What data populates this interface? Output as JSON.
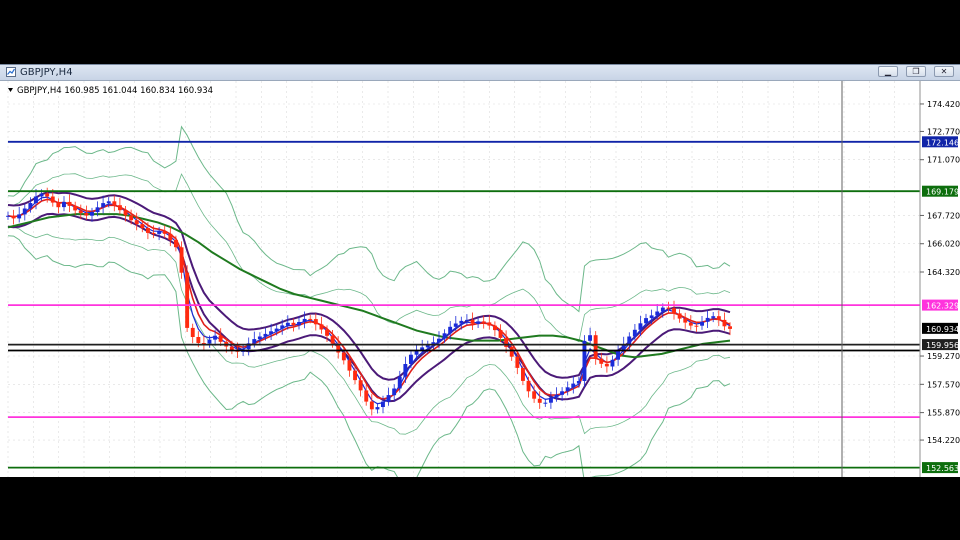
{
  "window": {
    "title": "GBPJPY,H4",
    "controls": [
      {
        "name": "minimize",
        "glyph": "▁"
      },
      {
        "name": "restore",
        "glyph": "❐"
      },
      {
        "name": "close",
        "glyph": "✕"
      }
    ]
  },
  "chart": {
    "info_line": "GBPJPY,H4  160.985 161.044 160.834 160.934",
    "colors": {
      "up": "#1a2bd8",
      "down": "#ff2a10",
      "grid": "#dcdcdc",
      "bb": "#6cb88a",
      "env": "#4b1a78",
      "ma_slow": "#1f7a1f",
      "ma_red": "#e0201a"
    },
    "price_axis": {
      "min": 152.0,
      "max": 175.8,
      "ticks": [
        "174.420",
        "172.770",
        "171.070",
        "167.720",
        "166.020",
        "164.320",
        "159.270",
        "157.570",
        "155.870",
        "154.220"
      ]
    },
    "hlines": [
      {
        "price": 172.146,
        "label": "172.146",
        "color": "#1024a8"
      },
      {
        "price": 169.179,
        "label": "169.179",
        "color": "#0d6e0d"
      },
      {
        "price": 162.329,
        "label": "162.329",
        "color": "#ff33dd"
      },
      {
        "price": 159.956,
        "label": "159.956",
        "color": "#202020"
      },
      {
        "price": 159.6,
        "label": "",
        "color": "#000000"
      },
      {
        "price": 155.6,
        "label": "",
        "color": "#ff33dd"
      },
      {
        "price": 152.563,
        "label": "152.563",
        "color": "#0d6e0d"
      }
    ],
    "current": {
      "price": 160.934,
      "label": "160.934",
      "color": "#000000"
    },
    "close_series": [
      167.7,
      167.5,
      168.0,
      168.4,
      168.9,
      169.1,
      168.6,
      168.2,
      168.6,
      168.1,
      167.9,
      167.7,
      168.0,
      168.4,
      168.6,
      168.3,
      167.9,
      167.5,
      167.2,
      166.9,
      166.5,
      166.8,
      166.6,
      166.1,
      165.5,
      161.0,
      160.3,
      159.9,
      160.2,
      160.5,
      160.0,
      159.7,
      159.5,
      159.7,
      160.2,
      160.4,
      160.6,
      160.8,
      161.0,
      161.3,
      161.1,
      161.4,
      161.6,
      161.2,
      160.8,
      160.3,
      159.6,
      159.0,
      158.2,
      157.5,
      156.6,
      156.0,
      156.3,
      156.8,
      157.3,
      158.2,
      159.2,
      159.6,
      159.8,
      160.0,
      160.2,
      160.6,
      161.1,
      161.3,
      161.5,
      161.2,
      161.4,
      161.2,
      160.9,
      160.3,
      159.6,
      158.8,
      157.8,
      157.0,
      156.5,
      156.4,
      156.8,
      157.0,
      157.3,
      157.6,
      157.8,
      161.5,
      159.2,
      158.8,
      158.6,
      159.4,
      159.9,
      160.5,
      161.0,
      161.5,
      161.7,
      162.0,
      162.3,
      161.9,
      161.5,
      161.2,
      161.0,
      161.3,
      161.6,
      161.7,
      161.1,
      160.9
    ],
    "ma_slow_series": [
      167.0,
      167.2,
      167.4,
      167.6,
      167.7,
      167.8,
      167.8,
      167.8,
      167.8,
      167.7,
      167.5,
      167.3,
      167.0,
      166.6,
      166.1,
      165.5,
      165.0,
      164.5,
      164.1,
      163.7,
      163.3,
      163.0,
      162.8,
      162.6,
      162.4,
      162.2,
      162.0,
      161.7,
      161.4,
      161.1,
      160.8,
      160.6,
      160.4,
      160.3,
      160.2,
      160.2,
      160.2,
      160.3,
      160.4,
      160.5,
      160.5,
      160.4,
      160.2,
      159.9,
      159.6,
      159.3,
      159.2,
      159.3,
      159.4,
      159.6,
      159.8,
      160.0,
      160.1,
      160.2
    ]
  }
}
